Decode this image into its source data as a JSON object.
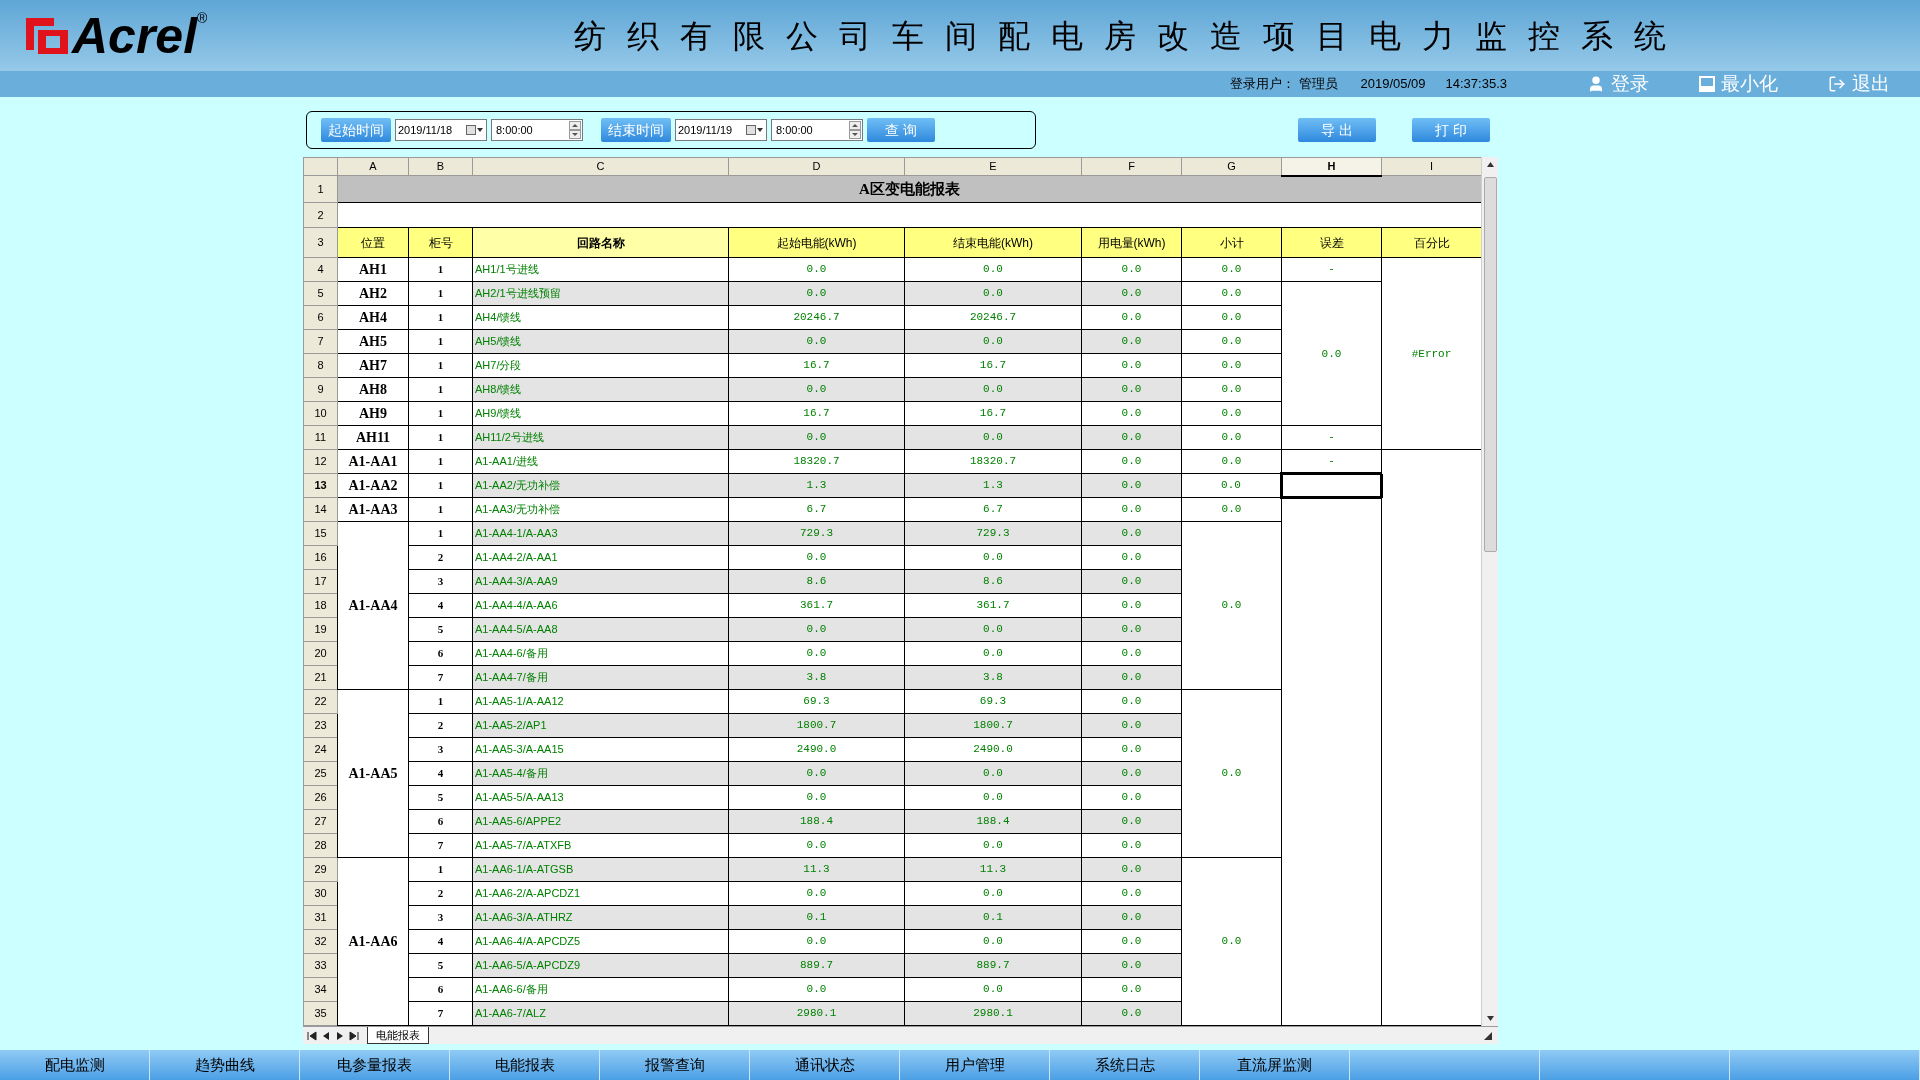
{
  "header": {
    "logo_text": "Acrel",
    "logo_mark": "®",
    "title": "纺织有限公司车间配电房改造项目电力监控系统",
    "user_label": "登录用户：",
    "user_name": "管理员",
    "date": "2019/05/09",
    "time": "14:37:35.3",
    "buttons": [
      {
        "kind": "login",
        "label": "登录"
      },
      {
        "kind": "minimize",
        "label": "最小化"
      },
      {
        "kind": "exit",
        "label": "退出"
      }
    ]
  },
  "query": {
    "start_label": "起始时间",
    "start_date": "2019/11/18",
    "start_time": "8:00:00",
    "end_label": "结束时间",
    "end_date": "2019/11/19",
    "end_time": "8:00:00",
    "search": "查 询",
    "export": "导 出",
    "print": "打 印"
  },
  "sheet": {
    "columns": [
      {
        "label": "A",
        "selected": false
      },
      {
        "label": "B",
        "selected": false
      },
      {
        "label": "C",
        "selected": false
      },
      {
        "label": "D",
        "selected": false
      },
      {
        "label": "E",
        "selected": false
      },
      {
        "label": "F",
        "selected": false
      },
      {
        "label": "G",
        "selected": false
      },
      {
        "label": "H",
        "selected": true
      },
      {
        "label": "I",
        "selected": false
      }
    ],
    "title_row": "1",
    "title": "A区变电能报表",
    "blank_row": "2",
    "header_row": "3",
    "headers": [
      "位置",
      "柜号",
      "回路名称",
      "起始电能(kWh)",
      "结束电能(kWh)",
      "用电量(kWh)",
      "小计",
      "误差",
      "百分比"
    ],
    "groups": [
      {
        "position": "AH1",
        "subtotal": "0.0",
        "rows": [
          {
            "row_number": "4",
            "cabinet": "1",
            "circuit": "AH1/1号进线",
            "start": "0.0",
            "end": "0.0",
            "usage": "0.0",
            "selected": false,
            "error": "-",
            "error_merged": false,
            "percent": "#Error",
            "percent_merged": false
          }
        ]
      },
      {
        "position": "AH2",
        "subtotal": "0.0",
        "rows": [
          {
            "row_number": "5",
            "cabinet": "1",
            "circuit": "AH2/1号进线预留",
            "start": "0.0",
            "end": "0.0",
            "usage": "0.0",
            "selected": false,
            "error": "0.0",
            "error_merged": false,
            "percent_merged": true
          }
        ]
      },
      {
        "position": "AH4",
        "subtotal": "0.0",
        "rows": [
          {
            "row_number": "6",
            "cabinet": "1",
            "circuit": "AH4/馈线",
            "start": "20246.7",
            "end": "20246.7",
            "usage": "0.0",
            "selected": false,
            "error_merged": true,
            "percent_merged": true
          }
        ]
      },
      {
        "position": "AH5",
        "subtotal": "0.0",
        "rows": [
          {
            "row_number": "7",
            "cabinet": "1",
            "circuit": "AH5/馈线",
            "start": "0.0",
            "end": "0.0",
            "usage": "0.0",
            "selected": false,
            "error_merged": true,
            "percent_merged": true
          }
        ]
      },
      {
        "position": "AH7",
        "subtotal": "0.0",
        "rows": [
          {
            "row_number": "8",
            "cabinet": "1",
            "circuit": "AH7/分段",
            "start": "16.7",
            "end": "16.7",
            "usage": "0.0",
            "selected": false,
            "error_merged": true,
            "percent_merged": true
          }
        ]
      },
      {
        "position": "AH8",
        "subtotal": "0.0",
        "rows": [
          {
            "row_number": "9",
            "cabinet": "1",
            "circuit": "AH8/馈线",
            "start": "0.0",
            "end": "0.0",
            "usage": "0.0",
            "selected": false,
            "error_merged": true,
            "percent_merged": true
          }
        ]
      },
      {
        "position": "AH9",
        "subtotal": "0.0",
        "rows": [
          {
            "row_number": "10",
            "cabinet": "1",
            "circuit": "AH9/馈线",
            "start": "16.7",
            "end": "16.7",
            "usage": "0.0",
            "selected": false,
            "error_merged": true,
            "percent_merged": true
          }
        ]
      },
      {
        "position": "AH11",
        "subtotal": "0.0",
        "rows": [
          {
            "row_number": "11",
            "cabinet": "1",
            "circuit": "AH11/2号进线",
            "start": "0.0",
            "end": "0.0",
            "usage": "0.0",
            "selected": false,
            "error": "-",
            "error_merged": false,
            "percent_merged": true
          }
        ]
      },
      {
        "position": "A1-AA1",
        "subtotal": "0.0",
        "rows": [
          {
            "row_number": "12",
            "cabinet": "1",
            "circuit": "A1-AA1/进线",
            "start": "18320.7",
            "end": "18320.7",
            "usage": "0.0",
            "selected": false,
            "error": "-",
            "error_merged": false,
            "percent_merged": false
          }
        ]
      },
      {
        "position": "A1-AA2",
        "subtotal": "0.0",
        "rows": [
          {
            "row_number": "13",
            "cabinet": "1",
            "circuit": "A1-AA2/无功补偿",
            "start": "1.3",
            "end": "1.3",
            "usage": "0.0",
            "selected": true,
            "error_merged": false,
            "percent_merged": true
          }
        ]
      },
      {
        "position": "A1-AA3",
        "subtotal": "0.0",
        "rows": [
          {
            "row_number": "14",
            "cabinet": "1",
            "circuit": "A1-AA3/无功补偿",
            "start": "6.7",
            "end": "6.7",
            "usage": "0.0",
            "selected": false,
            "error_merged": false,
            "percent_merged": true
          }
        ]
      },
      {
        "position": "A1-AA4",
        "subtotal": "0.0",
        "rows": [
          {
            "row_number": "15",
            "cabinet": "1",
            "circuit": "A1-AA4-1/A-AA3",
            "start": "729.3",
            "end": "729.3",
            "usage": "0.0",
            "selected": false,
            "error_merged": true,
            "percent_merged": true
          },
          {
            "row_number": "16",
            "cabinet": "2",
            "circuit": "A1-AA4-2/A-AA1",
            "start": "0.0",
            "end": "0.0",
            "usage": "0.0",
            "selected": false,
            "error_merged": true,
            "percent_merged": true
          },
          {
            "row_number": "17",
            "cabinet": "3",
            "circuit": "A1-AA4-3/A-AA9",
            "start": "8.6",
            "end": "8.6",
            "usage": "0.0",
            "selected": false,
            "error_merged": true,
            "percent_merged": true
          },
          {
            "row_number": "18",
            "cabinet": "4",
            "circuit": "A1-AA4-4/A-AA6",
            "start": "361.7",
            "end": "361.7",
            "usage": "0.0",
            "selected": false,
            "error_merged": true,
            "percent_merged": true
          },
          {
            "row_number": "19",
            "cabinet": "5",
            "circuit": "A1-AA4-5/A-AA8",
            "start": "0.0",
            "end": "0.0",
            "usage": "0.0",
            "selected": false,
            "error_merged": true,
            "percent_merged": true
          },
          {
            "row_number": "20",
            "cabinet": "6",
            "circuit": "A1-AA4-6/备用",
            "start": "0.0",
            "end": "0.0",
            "usage": "0.0",
            "selected": false,
            "error_merged": true,
            "percent_merged": true
          },
          {
            "row_number": "21",
            "cabinet": "7",
            "circuit": "A1-AA4-7/备用",
            "start": "3.8",
            "end": "3.8",
            "usage": "0.0",
            "selected": false,
            "error_merged": true,
            "percent_merged": true
          }
        ]
      },
      {
        "position": "A1-AA5",
        "subtotal": "0.0",
        "rows": [
          {
            "row_number": "22",
            "cabinet": "1",
            "circuit": "A1-AA5-1/A-AA12",
            "start": "69.3",
            "end": "69.3",
            "usage": "0.0",
            "selected": false,
            "error_merged": true,
            "percent_merged": true
          },
          {
            "row_number": "23",
            "cabinet": "2",
            "circuit": "A1-AA5-2/AP1",
            "start": "1800.7",
            "end": "1800.7",
            "usage": "0.0",
            "selected": false,
            "error_merged": true,
            "percent_merged": true
          },
          {
            "row_number": "24",
            "cabinet": "3",
            "circuit": "A1-AA5-3/A-AA15",
            "start": "2490.0",
            "end": "2490.0",
            "usage": "0.0",
            "selected": false,
            "error_merged": true,
            "percent_merged": true
          },
          {
            "row_number": "25",
            "cabinet": "4",
            "circuit": "A1-AA5-4/备用",
            "start": "0.0",
            "end": "0.0",
            "usage": "0.0",
            "selected": false,
            "error_merged": true,
            "percent_merged": true
          },
          {
            "row_number": "26",
            "cabinet": "5",
            "circuit": "A1-AA5-5/A-AA13",
            "start": "0.0",
            "end": "0.0",
            "usage": "0.0",
            "selected": false,
            "error_merged": true,
            "percent_merged": true
          },
          {
            "row_number": "27",
            "cabinet": "6",
            "circuit": "A1-AA5-6/APPE2",
            "start": "188.4",
            "end": "188.4",
            "usage": "0.0",
            "selected": false,
            "error_merged": true,
            "percent_merged": true
          },
          {
            "row_number": "28",
            "cabinet": "7",
            "circuit": "A1-AA5-7/A-ATXFB",
            "start": "0.0",
            "end": "0.0",
            "usage": "0.0",
            "selected": false,
            "error_merged": true,
            "percent_merged": true
          }
        ]
      },
      {
        "position": "A1-AA6",
        "subtotal": "0.0",
        "rows": [
          {
            "row_number": "29",
            "cabinet": "1",
            "circuit": "A1-AA6-1/A-ATGSB",
            "start": "11.3",
            "end": "11.3",
            "usage": "0.0",
            "selected": false,
            "error_merged": true,
            "percent_merged": true
          },
          {
            "row_number": "30",
            "cabinet": "2",
            "circuit": "A1-AA6-2/A-APCDZ1",
            "start": "0.0",
            "end": "0.0",
            "usage": "0.0",
            "selected": false,
            "error_merged": true,
            "percent_merged": true
          },
          {
            "row_number": "31",
            "cabinet": "3",
            "circuit": "A1-AA6-3/A-ATHRZ",
            "start": "0.1",
            "end": "0.1",
            "usage": "0.0",
            "selected": false,
            "error_merged": true,
            "percent_merged": true
          },
          {
            "row_number": "32",
            "cabinet": "4",
            "circuit": "A1-AA6-4/A-APCDZ5",
            "start": "0.0",
            "end": "0.0",
            "usage": "0.0",
            "selected": false,
            "error_merged": true,
            "percent_merged": true
          },
          {
            "row_number": "33",
            "cabinet": "5",
            "circuit": "A1-AA6-5/A-APCDZ9",
            "start": "889.7",
            "end": "889.7",
            "usage": "0.0",
            "selected": false,
            "error_merged": true,
            "percent_merged": true
          },
          {
            "row_number": "34",
            "cabinet": "6",
            "circuit": "A1-AA6-6/备用",
            "start": "0.0",
            "end": "0.0",
            "usage": "0.0",
            "selected": false,
            "error_merged": true,
            "percent_merged": true
          },
          {
            "row_number": "35",
            "cabinet": "7",
            "circuit": "A1-AA6-7/ALZ",
            "start": "2980.1",
            "end": "2980.1",
            "usage": "0.0",
            "selected": false,
            "error_merged": true,
            "percent_merged": true
          }
        ]
      }
    ],
    "sheet_tab": "电能报表"
  },
  "nav": [
    "配电监测",
    "趋势曲线",
    "电参量报表",
    "电能报表",
    "报警查询",
    "通讯状态",
    "用户管理",
    "系统日志",
    "直流屏监测"
  ]
}
